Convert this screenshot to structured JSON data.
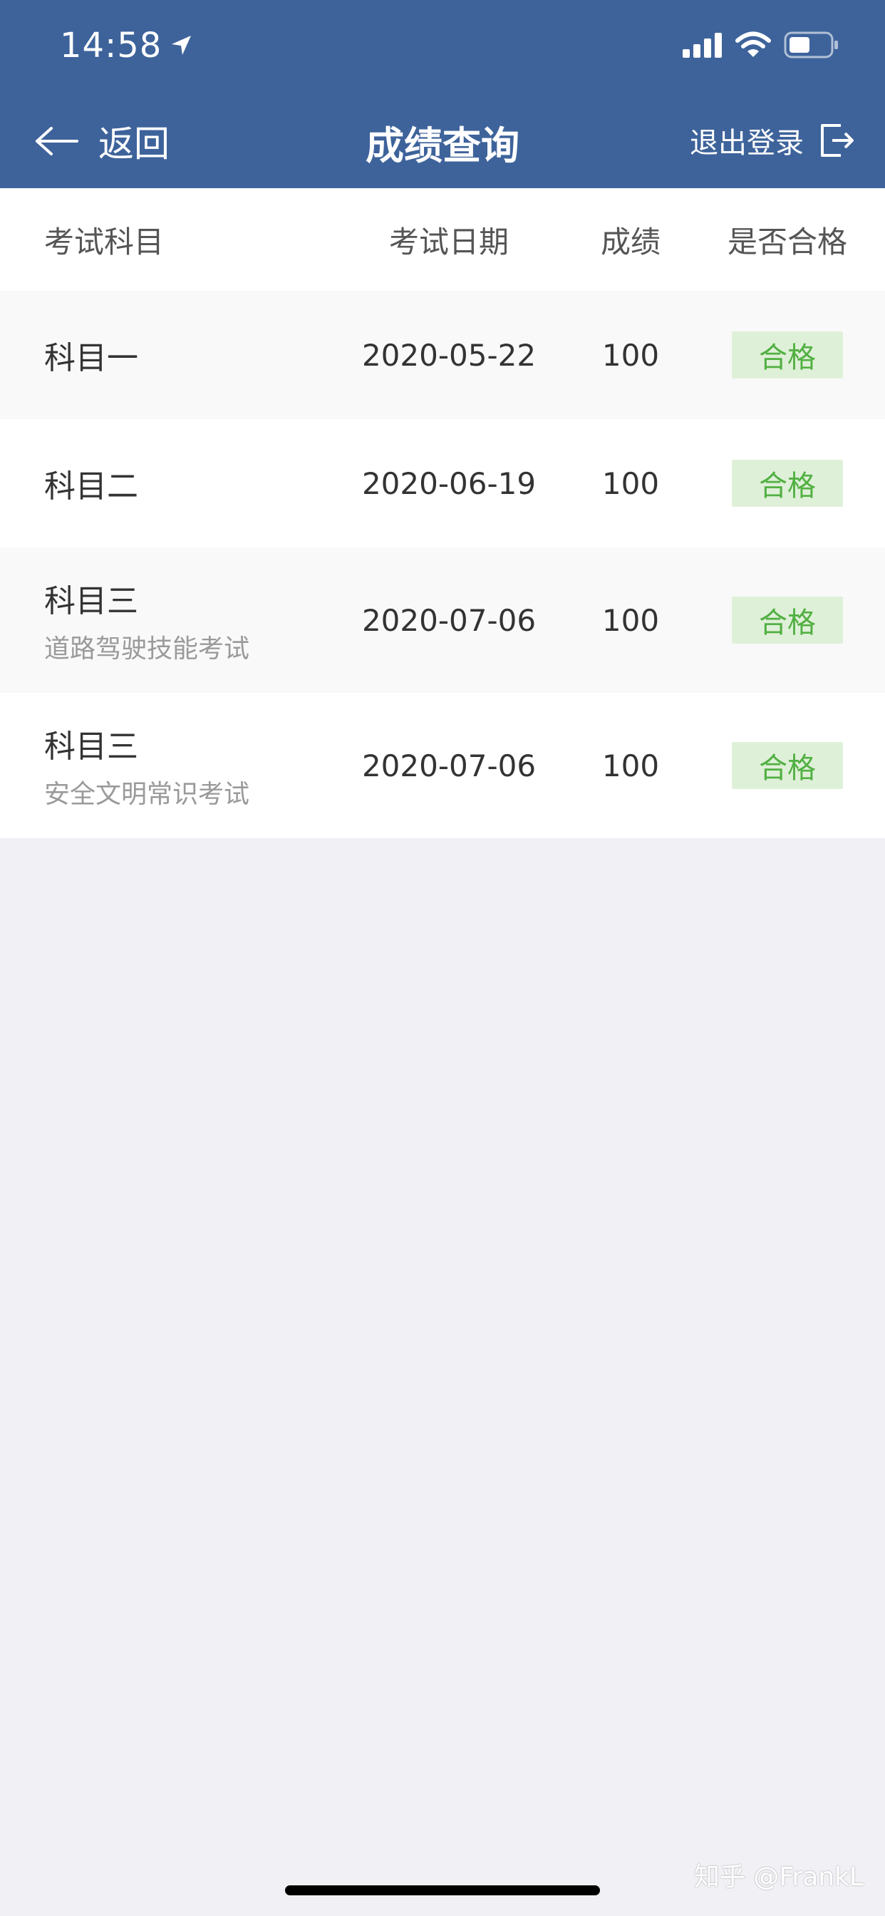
{
  "status_bar": {
    "time": "14:58"
  },
  "nav": {
    "back_label": "返回",
    "title": "成绩查询",
    "logout_label": "退出登录"
  },
  "table": {
    "headers": [
      "考试科目",
      "考试日期",
      "成绩",
      "是否合格"
    ],
    "rows": [
      {
        "subject": "科目一",
        "detail": "",
        "date": "2020-05-22",
        "score": "100",
        "result": "合格"
      },
      {
        "subject": "科目二",
        "detail": "",
        "date": "2020-06-19",
        "score": "100",
        "result": "合格"
      },
      {
        "subject": "科目三",
        "detail": "道路驾驶技能考试",
        "date": "2020-07-06",
        "score": "100",
        "result": "合格"
      },
      {
        "subject": "科目三",
        "detail": "安全文明常识考试",
        "date": "2020-07-06",
        "score": "100",
        "result": "合格"
      }
    ]
  },
  "watermark": "知乎 @FrankL",
  "colors": {
    "header_bg": "#3e639b",
    "page_bg": "#f0f0f5",
    "pass_badge_bg": "#dff0d8",
    "pass_badge_text": "#52b043"
  }
}
